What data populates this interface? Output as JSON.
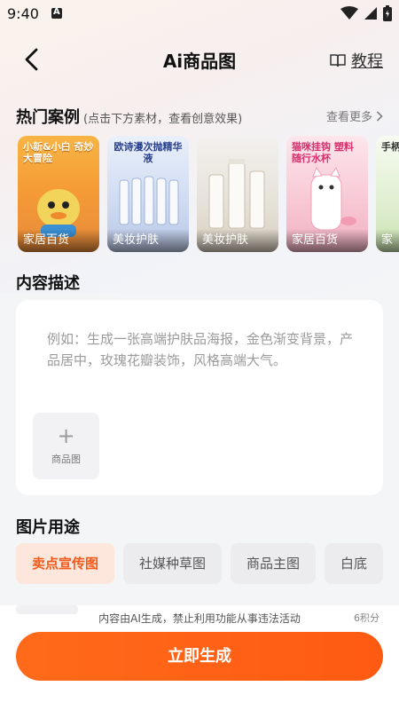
{
  "status_bar": {
    "time": "9:40",
    "notif_icon": "a-badge-icon"
  },
  "header": {
    "title": "Ai商品图",
    "tutorial_label": "教程"
  },
  "hot_cases": {
    "title": "热门案例",
    "hint": "(点击下方素材，查看创意效果)",
    "more_label": "查看更多",
    "items": [
      {
        "label": "家居百货",
        "headline": "小新&小白 奇妙大冒险"
      },
      {
        "label": "美妆护肤",
        "headline": "欧诗漫次抛精华液"
      },
      {
        "label": "美妆护肤",
        "headline": ""
      },
      {
        "label": "家居百货",
        "headline": "猫咪挂钩 塑料随行水杯"
      },
      {
        "label": "家",
        "headline": "手柄式"
      }
    ]
  },
  "description": {
    "title": "内容描述",
    "placeholder": "例如：生成一张高端护肤品海报，金色渐变背景，产品居中，玫瑰花瓣装饰，风格高端大气。",
    "upload_label": "商品图"
  },
  "usage": {
    "title": "图片用途",
    "options": [
      "卖点宣传图",
      "社媒种草图",
      "商品主图",
      "白底"
    ],
    "selected": "卖点宣传图"
  },
  "footer": {
    "notice": "内容由AI生成，禁止利用功能从事违法活动",
    "credits": "6积分",
    "generate_label": "立即生成"
  },
  "colors": {
    "accent": "#ff5f14",
    "selected_chip_bg": "#fde6dc",
    "selected_chip_text": "#f05a1a"
  }
}
